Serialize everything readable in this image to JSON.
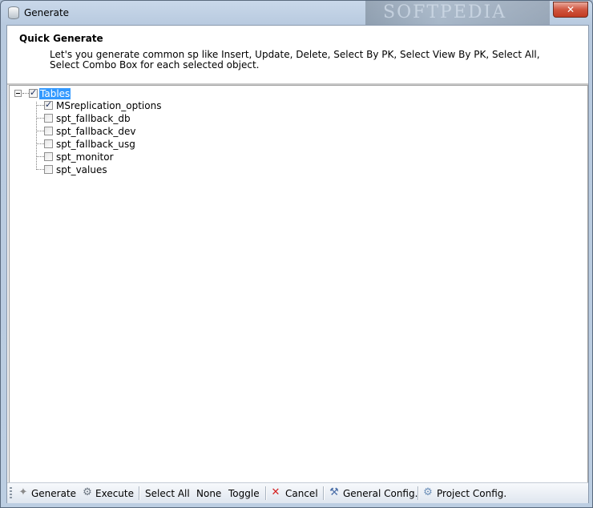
{
  "window": {
    "title": "Generate",
    "watermark": "SOFTPEDIA",
    "close_label": "✕"
  },
  "header": {
    "title": "Quick Generate",
    "description": "Let's you generate common sp like Insert, Update, Delete, Select By PK, Select View By PK, Select All, Select Combo Box for each selected object."
  },
  "tree": {
    "root": {
      "label": "Tables",
      "checked": true
    },
    "children": [
      {
        "label": "MSreplication_options",
        "checked": true
      },
      {
        "label": "spt_fallback_db",
        "checked": false
      },
      {
        "label": "spt_fallback_dev",
        "checked": false
      },
      {
        "label": "spt_fallback_usg",
        "checked": false
      },
      {
        "label": "spt_monitor",
        "checked": false
      },
      {
        "label": "spt_values",
        "checked": false
      }
    ]
  },
  "toolbar": {
    "generate": "Generate",
    "execute": "Execute",
    "select_all": "Select All",
    "none": "None",
    "toggle": "Toggle",
    "cancel": "Cancel",
    "general_config": "General Config.",
    "project_config": "Project Config.",
    "icons": {
      "generate": "wand-icon",
      "execute": "gears-icon",
      "cancel": "cancel-x-icon",
      "general_config": "tools-icon",
      "project_config": "project-settings-icon"
    }
  },
  "colors": {
    "selection": "#3399ff",
    "cancel_red": "#d42020"
  }
}
